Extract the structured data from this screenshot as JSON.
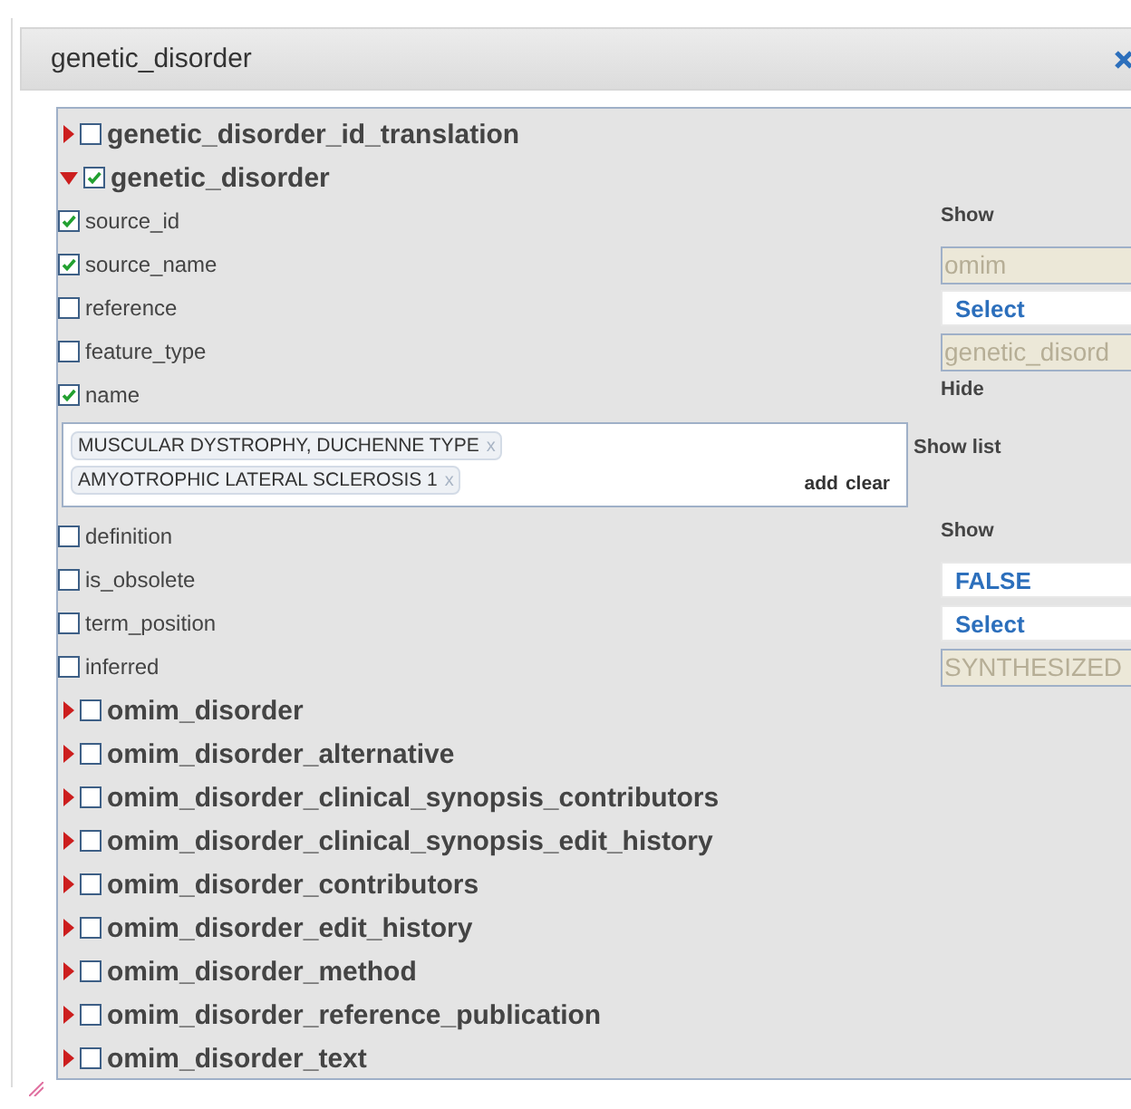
{
  "dialog": {
    "title": "genetic_disorder"
  },
  "tables": [
    {
      "label": "genetic_disorder_id_translation",
      "checked": false,
      "expanded": false
    },
    {
      "label": "genetic_disorder",
      "checked": true,
      "expanded": true,
      "fields": [
        {
          "label": "source_id",
          "checked": true,
          "control": {
            "kind": "label",
            "text": "Show"
          }
        },
        {
          "label": "source_name",
          "checked": true,
          "control": {
            "kind": "input",
            "value": "omim"
          }
        },
        {
          "label": "reference",
          "checked": false,
          "control": {
            "kind": "select",
            "value": "Select"
          }
        },
        {
          "label": "feature_type",
          "checked": false,
          "control": {
            "kind": "input",
            "value": "genetic_disord"
          }
        },
        {
          "label": "name",
          "checked": true,
          "control": {
            "kind": "label",
            "text": "Hide"
          },
          "filter": {
            "tags": [
              {
                "text": "MUSCULAR DYSTROPHY, DUCHENNE TYPE",
                "remove": "x"
              },
              {
                "text": "AMYOTROPHIC LATERAL SCLEROSIS 1",
                "remove": "x"
              }
            ],
            "actions": [
              "add",
              "clear"
            ],
            "toggle": "Show list"
          }
        },
        {
          "label": "definition",
          "checked": false,
          "control": {
            "kind": "label",
            "text": "Show"
          }
        },
        {
          "label": "is_obsolete",
          "checked": false,
          "control": {
            "kind": "select",
            "value": "FALSE"
          }
        },
        {
          "label": "term_position",
          "checked": false,
          "control": {
            "kind": "select",
            "value": "Select"
          }
        },
        {
          "label": "inferred",
          "checked": false,
          "control": {
            "kind": "input",
            "value": "SYNTHESIZED"
          }
        }
      ]
    },
    {
      "label": "omim_disorder",
      "checked": false,
      "expanded": false
    },
    {
      "label": "omim_disorder_alternative",
      "checked": false,
      "expanded": false
    },
    {
      "label": "omim_disorder_clinical_synopsis_contributors",
      "checked": false,
      "expanded": false
    },
    {
      "label": "omim_disorder_clinical_synopsis_edit_history",
      "checked": false,
      "expanded": false
    },
    {
      "label": "omim_disorder_contributors",
      "checked": false,
      "expanded": false
    },
    {
      "label": "omim_disorder_edit_history",
      "checked": false,
      "expanded": false
    },
    {
      "label": "omim_disorder_method",
      "checked": false,
      "expanded": false
    },
    {
      "label": "omim_disorder_reference_publication",
      "checked": false,
      "expanded": false
    },
    {
      "label": "omim_disorder_text",
      "checked": false,
      "expanded": false
    }
  ]
}
